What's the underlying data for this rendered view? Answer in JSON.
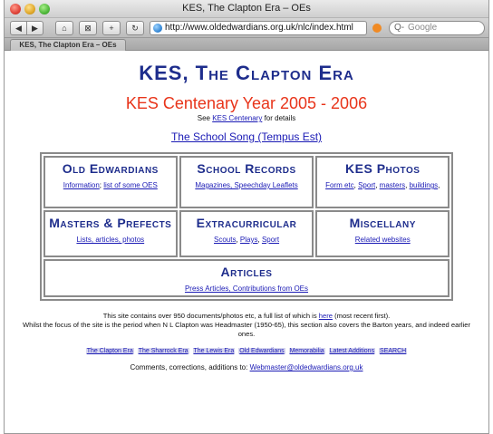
{
  "browser": {
    "window_title": "KES, The Clapton Era – OEs",
    "url": "http://www.oldedwardians.org.uk/nlc/index.html",
    "search_placeholder": "Google",
    "tab_label": "KES, The Clapton Era – OEs"
  },
  "page": {
    "title": "KES, The Clapton Era",
    "centenary_heading": "KES Centenary Year 2005 - 2006",
    "see_prefix": "See",
    "see_link": "KES Centenary",
    "see_suffix": "for details",
    "song_link": "The School Song (Tempus Est)",
    "sections": {
      "old_edwardians": {
        "heading": "Old Edwardians",
        "links": [
          "Information",
          "list of some OES"
        ]
      },
      "school_records": {
        "heading": "School Records",
        "links": [
          "Magazines, Speechday Leaflets"
        ]
      },
      "kes_photos": {
        "heading": "KES Photos",
        "links": [
          "Form etc",
          "Sport",
          "masters",
          "buildings"
        ]
      },
      "masters_prefects": {
        "heading": "Masters & Prefects",
        "links": [
          "Lists, articles, photos"
        ]
      },
      "extracurricular": {
        "heading": "Extracurricular",
        "links": [
          "Scouts",
          "Plays",
          "Sport"
        ]
      },
      "miscellany": {
        "heading": "Miscellany",
        "links": [
          "Related websites"
        ]
      },
      "articles": {
        "heading": "Articles",
        "links": [
          "Press Articles, Contributions from OEs"
        ]
      }
    },
    "info": {
      "line1_prefix": "This site contains over 950 documents/photos etc, a full list of which is",
      "line1_link": "here",
      "line1_suffix": "(most recent first).",
      "line2": "Whilst the focus of the site is the period when N L Clapton was Headmaster (1950-65), this section also covers the Barton years, and indeed earlier ones."
    },
    "nav": [
      "The Clapton Era",
      "The Sharrock Era",
      "The Lewis Era",
      "Old Edwardians",
      "Memorabilia",
      "Latest Additions",
      "SEARCH"
    ],
    "contact_prefix": "Comments, corrections, additions to:",
    "contact_email": "Webmaster@oldedwardians.org.uk"
  }
}
